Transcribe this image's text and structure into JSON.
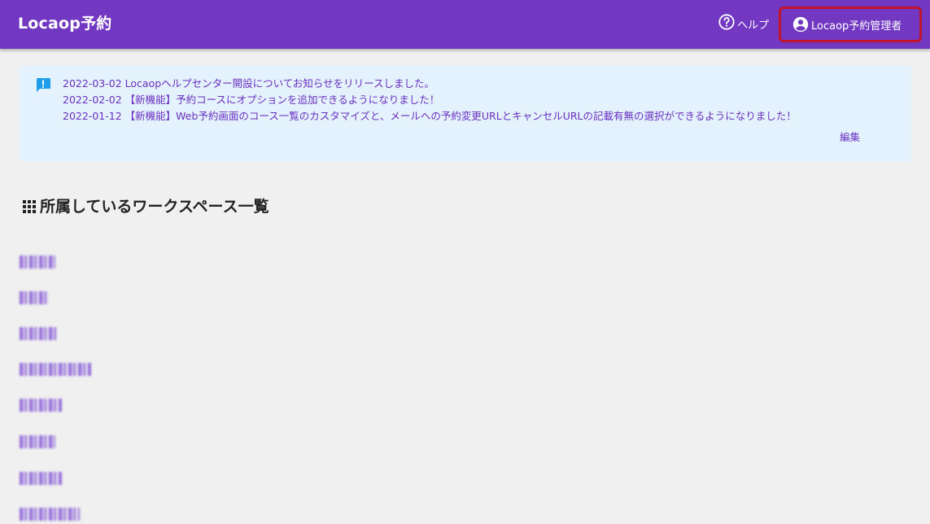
{
  "header": {
    "title": "Locaop予約",
    "help_label": "ヘルプ",
    "help_icon": "help-circle-icon",
    "user_label": "Locaop予約管理者",
    "user_icon": "account-circle-icon"
  },
  "notice": {
    "icon": "message-alert-icon",
    "items": [
      {
        "date": "2022-03-02",
        "text": "Locaopヘルプセンター開設についてお知らせをリリースしました。"
      },
      {
        "date": "2022-02-02",
        "text": "【新機能】予約コースにオプションを追加できるようになりました！"
      },
      {
        "date": "2022-01-12",
        "text": "【新機能】Web予約画面のコース一覧のカスタマイズと、メールへの予約変更URLとキャンセルURLの記載有無の選択ができるようになりました！"
      }
    ],
    "edit_label": "編集"
  },
  "workspaces": {
    "title": "所属しているワークスペース一覧",
    "icon": "apps-grid-icon",
    "items_note": "blurred",
    "items": [
      "",
      "",
      "",
      "",
      "",
      "",
      "",
      ""
    ]
  },
  "colors": {
    "appbar": "#7238c2",
    "highlight": "#c0142c",
    "notice_bg": "#e3f2fd",
    "link": "#6a2fbf"
  }
}
